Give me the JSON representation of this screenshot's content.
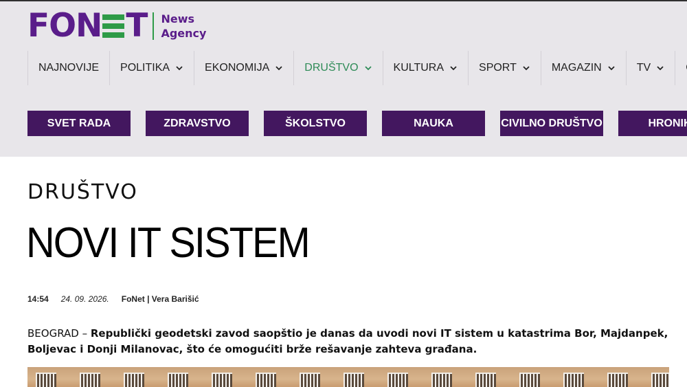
{
  "logo": {
    "word_left": "FON",
    "word_right": "T",
    "sub_line1": "News",
    "sub_line2": "Agency"
  },
  "nav": {
    "items": [
      {
        "label": "NAJNOVIJE",
        "has_dropdown": false,
        "active": false
      },
      {
        "label": "POLITIKA",
        "has_dropdown": true,
        "active": false
      },
      {
        "label": "EKONOMIJA",
        "has_dropdown": true,
        "active": false
      },
      {
        "label": "DRUŠTVO",
        "has_dropdown": true,
        "active": true
      },
      {
        "label": "KULTURA",
        "has_dropdown": true,
        "active": false
      },
      {
        "label": "SPORT",
        "has_dropdown": true,
        "active": false
      },
      {
        "label": "MAGAZIN",
        "has_dropdown": true,
        "active": false
      },
      {
        "label": "TV",
        "has_dropdown": true,
        "active": false
      },
      {
        "label": "OSTA",
        "has_dropdown": false,
        "active": false
      }
    ]
  },
  "subnav": {
    "items": [
      "SVET RADA",
      "ZDRAVSTVO",
      "ŠKOLSTVO",
      "NAUKA",
      "CIVILNO DRUŠTVO",
      "HRONIK"
    ]
  },
  "article": {
    "category": "DRUŠTVO",
    "title": "NOVI IT SISTEM",
    "time": "14:54",
    "date": "24. 09. 2026.",
    "source": "FoNet | Vera Barišić",
    "lead_place": "BEOGRAD – ",
    "lead_text": "Republički geodetski zavod saopštio je danas da uvodi novi IT sistem u katastrima Bor, Majdanpek, Boljevac i Donji Milanovac, što će omogućiti brže rešavanje zahteva građana."
  },
  "colors": {
    "brand_purple": "#5a1d8a",
    "brand_green": "#2e9b47",
    "subnav_bg": "#43175f",
    "header_bg": "#e8e6ea",
    "active_nav": "#2e8b57"
  },
  "icons": {
    "dropdown": "chevron-down-icon"
  }
}
